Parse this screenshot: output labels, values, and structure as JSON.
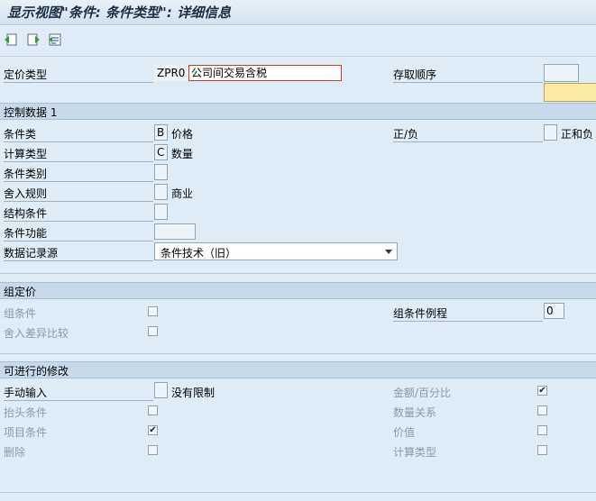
{
  "title": "显示视图\"条件: 条件类型\": 详细信息",
  "pricing": {
    "label": "定价类型",
    "code": "ZPR0",
    "name": "公司间交易含税",
    "access_seq_label": "存取顺序",
    "access_seq_value": ""
  },
  "control": {
    "header": "控制数据 1",
    "cond_class_label": "条件类",
    "cond_class_value": "B",
    "cond_class_text": "价格",
    "calc_type_label": "计算类型",
    "calc_type_value": "C",
    "calc_type_text": "数量",
    "cond_category_label": "条件类别",
    "rounding_label": "舍入规则",
    "rounding_text": "商业",
    "struct_cond_label": "结构条件",
    "cond_func_label": "条件功能",
    "source_label": "数据记录源",
    "source_value": "条件技术（旧）",
    "plus_minus_label": "正/负",
    "plus_minus_text": "正和负"
  },
  "group": {
    "header": "组定价",
    "group_cond_label": "组条件",
    "rounding_diff_label": "舍入差异比较",
    "group_routine_label": "组条件例程",
    "group_routine_value": "0"
  },
  "changes": {
    "header": "可进行的修改",
    "manual_label": "手动输入",
    "manual_text": "没有限制",
    "header_cond_label": "抬头条件",
    "item_cond_label": "项目条件",
    "delete_label": "删除",
    "amount_label": "金额/百分比",
    "qty_rel_label": "数量关系",
    "value_label": "价值",
    "calc_type_label": "计算类型"
  },
  "checks": {
    "group_cond": false,
    "rounding_diff": false,
    "header_cond": false,
    "item_cond": true,
    "delete": false,
    "amount": true,
    "qty_rel": false,
    "value": false,
    "calc_type": false
  }
}
